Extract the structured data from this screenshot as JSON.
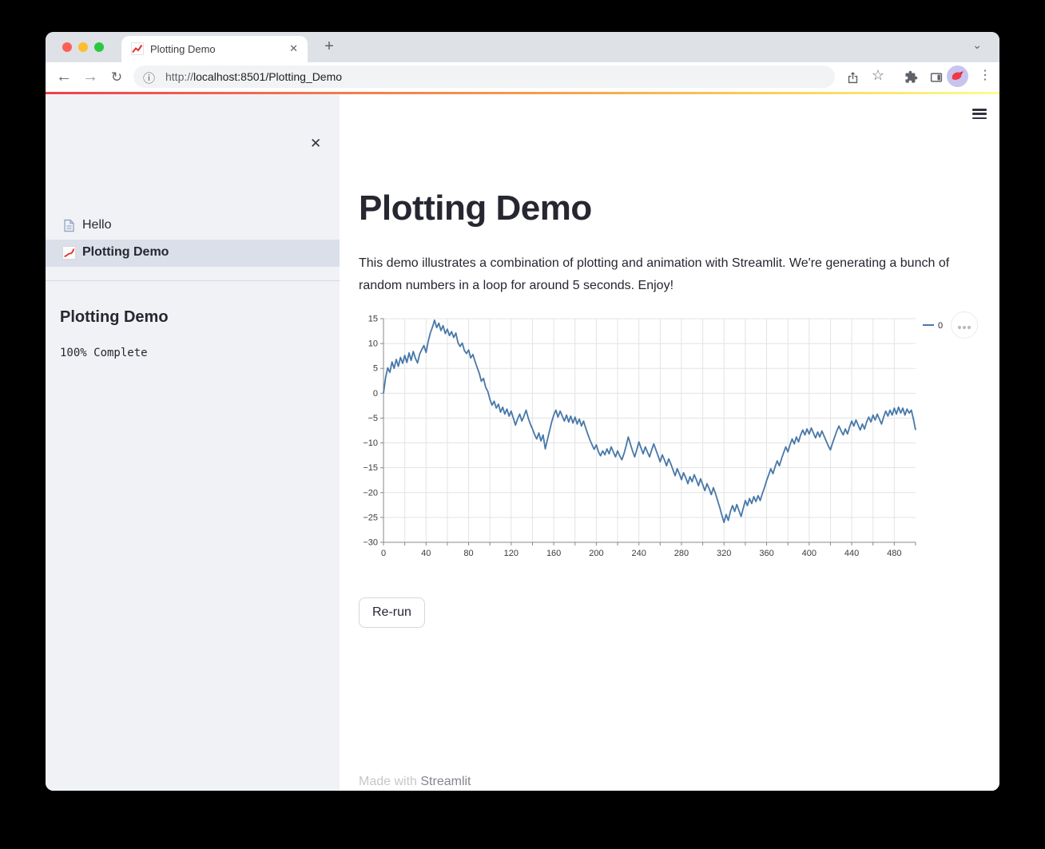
{
  "browser": {
    "tab": {
      "title": "Plotting Demo"
    },
    "new_tab_label": "+",
    "url": {
      "scheme": "http://",
      "rest": "localhost:8501/Plotting_Demo"
    },
    "traffic_lights": {
      "close": "#ff5f57",
      "minimize": "#febc2e",
      "maximize": "#28c840"
    }
  },
  "sidebar": {
    "nav": [
      {
        "label": "Hello",
        "icon": "document-icon",
        "selected": false
      },
      {
        "label": "Plotting Demo",
        "icon": "line-chart-icon",
        "selected": true
      }
    ],
    "heading": "Plotting Demo",
    "status": "100% Complete"
  },
  "main": {
    "title": "Plotting Demo",
    "description": "This demo illustrates a combination of plotting and animation with Streamlit. We're generating a bunch of random numbers in a loop for around 5 seconds. Enjoy!",
    "rerun_label": "Re-run",
    "footer": {
      "prefix": "Made with ",
      "link": "Streamlit"
    }
  },
  "chart_data": {
    "type": "line",
    "title": "",
    "xlabel": "",
    "ylabel": "",
    "xlim": [
      0,
      500
    ],
    "ylim": [
      -30,
      15
    ],
    "x_label_ticks": [
      0,
      40,
      80,
      120,
      160,
      200,
      240,
      280,
      320,
      360,
      400,
      440,
      480
    ],
    "x_minor_step": 20,
    "y_ticks": [
      15,
      10,
      5,
      0,
      -5,
      -10,
      -15,
      -20,
      -25,
      -30
    ],
    "grid": true,
    "legend_position": "right",
    "colors": {
      "line": "#4878a8",
      "grid": "#e3e3e3",
      "axis": "#888888",
      "label": "#3b3b3b"
    },
    "series": [
      {
        "name": "0",
        "points": [
          [
            0,
            0
          ],
          [
            2,
            3.2
          ],
          [
            4,
            5.1
          ],
          [
            6,
            4.2
          ],
          [
            8,
            6.3
          ],
          [
            10,
            5.0
          ],
          [
            12,
            6.8
          ],
          [
            14,
            5.4
          ],
          [
            16,
            7.2
          ],
          [
            18,
            6.0
          ],
          [
            20,
            7.6
          ],
          [
            22,
            6.2
          ],
          [
            24,
            8.1
          ],
          [
            26,
            6.6
          ],
          [
            28,
            8.4
          ],
          [
            30,
            7.0
          ],
          [
            32,
            6.1
          ],
          [
            34,
            7.9
          ],
          [
            36,
            8.8
          ],
          [
            38,
            9.6
          ],
          [
            40,
            8.2
          ],
          [
            42,
            10.4
          ],
          [
            44,
            12.1
          ],
          [
            46,
            13.3
          ],
          [
            48,
            14.7
          ],
          [
            50,
            13.2
          ],
          [
            52,
            14.1
          ],
          [
            54,
            12.6
          ],
          [
            56,
            13.6
          ],
          [
            58,
            12.0
          ],
          [
            60,
            12.9
          ],
          [
            62,
            11.6
          ],
          [
            64,
            12.4
          ],
          [
            66,
            11.2
          ],
          [
            68,
            12.1
          ],
          [
            70,
            10.2
          ],
          [
            72,
            9.4
          ],
          [
            74,
            10.1
          ],
          [
            76,
            8.6
          ],
          [
            78,
            8.0
          ],
          [
            80,
            8.7
          ],
          [
            82,
            7.1
          ],
          [
            84,
            7.8
          ],
          [
            86,
            6.4
          ],
          [
            88,
            5.2
          ],
          [
            90,
            4.0
          ],
          [
            92,
            2.4
          ],
          [
            94,
            3.0
          ],
          [
            96,
            1.2
          ],
          [
            98,
            0.4
          ],
          [
            100,
            -1.2
          ],
          [
            102,
            -2.4
          ],
          [
            104,
            -1.6
          ],
          [
            106,
            -3.0
          ],
          [
            108,
            -2.2
          ],
          [
            110,
            -3.8
          ],
          [
            112,
            -2.8
          ],
          [
            114,
            -4.2
          ],
          [
            116,
            -3.2
          ],
          [
            118,
            -4.6
          ],
          [
            120,
            -3.6
          ],
          [
            122,
            -5.0
          ],
          [
            124,
            -6.4
          ],
          [
            126,
            -5.2
          ],
          [
            128,
            -4.2
          ],
          [
            130,
            -5.6
          ],
          [
            132,
            -4.6
          ],
          [
            134,
            -3.4
          ],
          [
            136,
            -5.0
          ],
          [
            138,
            -6.2
          ],
          [
            140,
            -7.2
          ],
          [
            142,
            -8.3
          ],
          [
            144,
            -9.2
          ],
          [
            146,
            -8.0
          ],
          [
            148,
            -9.6
          ],
          [
            150,
            -8.4
          ],
          [
            152,
            -11.2
          ],
          [
            154,
            -9.4
          ],
          [
            156,
            -7.6
          ],
          [
            158,
            -5.8
          ],
          [
            160,
            -4.4
          ],
          [
            162,
            -3.4
          ],
          [
            164,
            -4.8
          ],
          [
            166,
            -3.6
          ],
          [
            168,
            -4.6
          ],
          [
            170,
            -5.6
          ],
          [
            172,
            -4.4
          ],
          [
            174,
            -5.8
          ],
          [
            176,
            -4.6
          ],
          [
            178,
            -6.0
          ],
          [
            180,
            -4.8
          ],
          [
            182,
            -6.2
          ],
          [
            184,
            -5.2
          ],
          [
            186,
            -6.6
          ],
          [
            188,
            -5.6
          ],
          [
            190,
            -7.0
          ],
          [
            192,
            -8.2
          ],
          [
            194,
            -9.4
          ],
          [
            196,
            -10.4
          ],
          [
            198,
            -11.3
          ],
          [
            200,
            -10.4
          ],
          [
            202,
            -11.8
          ],
          [
            204,
            -12.6
          ],
          [
            206,
            -11.6
          ],
          [
            208,
            -12.4
          ],
          [
            210,
            -11.2
          ],
          [
            212,
            -12.2
          ],
          [
            214,
            -10.8
          ],
          [
            216,
            -11.8
          ],
          [
            218,
            -12.8
          ],
          [
            220,
            -11.6
          ],
          [
            222,
            -12.6
          ],
          [
            224,
            -13.4
          ],
          [
            226,
            -12.2
          ],
          [
            228,
            -10.6
          ],
          [
            230,
            -8.8
          ],
          [
            232,
            -10.2
          ],
          [
            234,
            -11.6
          ],
          [
            236,
            -12.8
          ],
          [
            238,
            -11.4
          ],
          [
            240,
            -9.8
          ],
          [
            242,
            -11.0
          ],
          [
            244,
            -12.2
          ],
          [
            246,
            -10.8
          ],
          [
            248,
            -11.8
          ],
          [
            250,
            -12.8
          ],
          [
            252,
            -11.4
          ],
          [
            254,
            -10.2
          ],
          [
            256,
            -11.4
          ],
          [
            258,
            -12.6
          ],
          [
            260,
            -13.8
          ],
          [
            262,
            -12.4
          ],
          [
            264,
            -13.4
          ],
          [
            266,
            -14.6
          ],
          [
            268,
            -13.2
          ],
          [
            270,
            -14.2
          ],
          [
            272,
            -15.4
          ],
          [
            274,
            -16.6
          ],
          [
            276,
            -15.2
          ],
          [
            278,
            -16.2
          ],
          [
            280,
            -17.4
          ],
          [
            282,
            -16.0
          ],
          [
            284,
            -17.0
          ],
          [
            286,
            -18.2
          ],
          [
            288,
            -16.8
          ],
          [
            290,
            -17.8
          ],
          [
            292,
            -16.4
          ],
          [
            294,
            -17.4
          ],
          [
            296,
            -18.6
          ],
          [
            298,
            -17.2
          ],
          [
            300,
            -18.4
          ],
          [
            302,
            -19.6
          ],
          [
            304,
            -18.2
          ],
          [
            306,
            -19.2
          ],
          [
            308,
            -20.4
          ],
          [
            310,
            -19.0
          ],
          [
            312,
            -20.2
          ],
          [
            314,
            -21.6
          ],
          [
            316,
            -23.0
          ],
          [
            318,
            -24.6
          ],
          [
            320,
            -26.0
          ],
          [
            322,
            -24.4
          ],
          [
            324,
            -25.6
          ],
          [
            326,
            -23.8
          ],
          [
            328,
            -22.6
          ],
          [
            330,
            -23.8
          ],
          [
            332,
            -22.4
          ],
          [
            334,
            -23.6
          ],
          [
            336,
            -24.8
          ],
          [
            338,
            -23.2
          ],
          [
            340,
            -21.6
          ],
          [
            342,
            -22.6
          ],
          [
            344,
            -21.2
          ],
          [
            346,
            -22.2
          ],
          [
            348,
            -20.8
          ],
          [
            350,
            -21.8
          ],
          [
            352,
            -20.6
          ],
          [
            354,
            -21.6
          ],
          [
            356,
            -20.2
          ],
          [
            358,
            -19.0
          ],
          [
            360,
            -17.6
          ],
          [
            362,
            -16.4
          ],
          [
            364,
            -15.2
          ],
          [
            366,
            -16.2
          ],
          [
            368,
            -14.8
          ],
          [
            370,
            -13.6
          ],
          [
            372,
            -14.6
          ],
          [
            374,
            -13.2
          ],
          [
            376,
            -12.0
          ],
          [
            378,
            -10.8
          ],
          [
            380,
            -11.8
          ],
          [
            382,
            -10.4
          ],
          [
            384,
            -9.2
          ],
          [
            386,
            -10.2
          ],
          [
            388,
            -8.8
          ],
          [
            390,
            -9.8
          ],
          [
            392,
            -8.4
          ],
          [
            394,
            -7.4
          ],
          [
            396,
            -8.4
          ],
          [
            398,
            -7.2
          ],
          [
            400,
            -8.2
          ],
          [
            402,
            -7.0
          ],
          [
            404,
            -8.0
          ],
          [
            406,
            -9.0
          ],
          [
            408,
            -7.8
          ],
          [
            410,
            -8.8
          ],
          [
            412,
            -7.6
          ],
          [
            414,
            -8.6
          ],
          [
            416,
            -9.6
          ],
          [
            418,
            -10.6
          ],
          [
            420,
            -11.4
          ],
          [
            422,
            -10.0
          ],
          [
            424,
            -8.8
          ],
          [
            426,
            -7.6
          ],
          [
            428,
            -6.6
          ],
          [
            430,
            -7.6
          ],
          [
            432,
            -8.4
          ],
          [
            434,
            -7.2
          ],
          [
            436,
            -8.2
          ],
          [
            438,
            -6.8
          ],
          [
            440,
            -5.6
          ],
          [
            442,
            -6.6
          ],
          [
            444,
            -5.4
          ],
          [
            446,
            -6.4
          ],
          [
            448,
            -7.4
          ],
          [
            450,
            -6.2
          ],
          [
            452,
            -7.2
          ],
          [
            454,
            -5.8
          ],
          [
            456,
            -4.8
          ],
          [
            458,
            -5.8
          ],
          [
            460,
            -4.4
          ],
          [
            462,
            -5.4
          ],
          [
            464,
            -4.2
          ],
          [
            466,
            -5.2
          ],
          [
            468,
            -6.2
          ],
          [
            470,
            -4.8
          ],
          [
            472,
            -3.6
          ],
          [
            474,
            -4.6
          ],
          [
            476,
            -3.4
          ],
          [
            478,
            -4.4
          ],
          [
            480,
            -3.0
          ],
          [
            482,
            -4.2
          ],
          [
            484,
            -2.8
          ],
          [
            486,
            -4.0
          ],
          [
            488,
            -3.0
          ],
          [
            490,
            -4.4
          ],
          [
            492,
            -3.2
          ],
          [
            494,
            -4.0
          ],
          [
            496,
            -3.4
          ],
          [
            498,
            -5.2
          ],
          [
            500,
            -7.4
          ]
        ]
      }
    ]
  }
}
